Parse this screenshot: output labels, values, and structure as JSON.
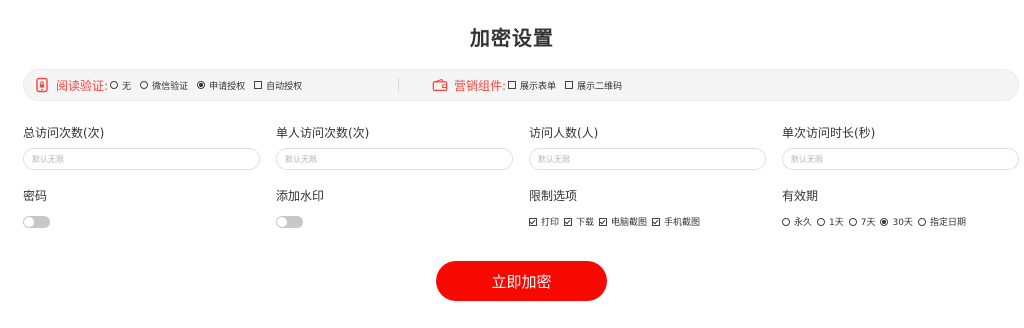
{
  "page": {
    "title": "加密设置"
  },
  "bar": {
    "read_verify": {
      "icon": "phone-lock-icon",
      "label": "阅读验证:",
      "options": [
        {
          "label": "无",
          "selected": false
        },
        {
          "label": "微信验证",
          "selected": false
        },
        {
          "label": "申请授权",
          "selected": true
        },
        {
          "label": "自动授权",
          "selected": false
        }
      ]
    },
    "marketing": {
      "icon": "wallet-icon",
      "label": "营销组件:",
      "options": [
        {
          "label": "展示表单",
          "checked": false
        },
        {
          "label": "展示二维码",
          "checked": false
        }
      ]
    }
  },
  "fields": {
    "total_visits": {
      "label": "总访问次数(次)",
      "placeholder": "默认无限"
    },
    "single_visits": {
      "label": "单人访问次数(次)",
      "placeholder": "默认无限"
    },
    "visitors": {
      "label": "访问人数(人)",
      "placeholder": "默认无限"
    },
    "duration": {
      "label": "单次访问时长(秒)",
      "placeholder": "默认无限"
    }
  },
  "password": {
    "label": "密码",
    "enabled": false
  },
  "watermark": {
    "label": "添加水印",
    "enabled": false
  },
  "restrictions": {
    "label": "限制选项",
    "options": [
      {
        "label": "打印",
        "checked": true
      },
      {
        "label": "下载",
        "checked": true
      },
      {
        "label": "电脑截图",
        "checked": true
      },
      {
        "label": "手机截图",
        "checked": true
      }
    ]
  },
  "validity": {
    "label": "有效期",
    "options": [
      {
        "label": "永久",
        "selected": false
      },
      {
        "label": "1天",
        "selected": false
      },
      {
        "label": "7天",
        "selected": false
      },
      {
        "label": "30天",
        "selected": true
      },
      {
        "label": "指定日期",
        "selected": false
      }
    ]
  },
  "submit": {
    "label": "立即加密"
  },
  "colors": {
    "accent": "#f70800",
    "group_label": "#f5463f"
  }
}
